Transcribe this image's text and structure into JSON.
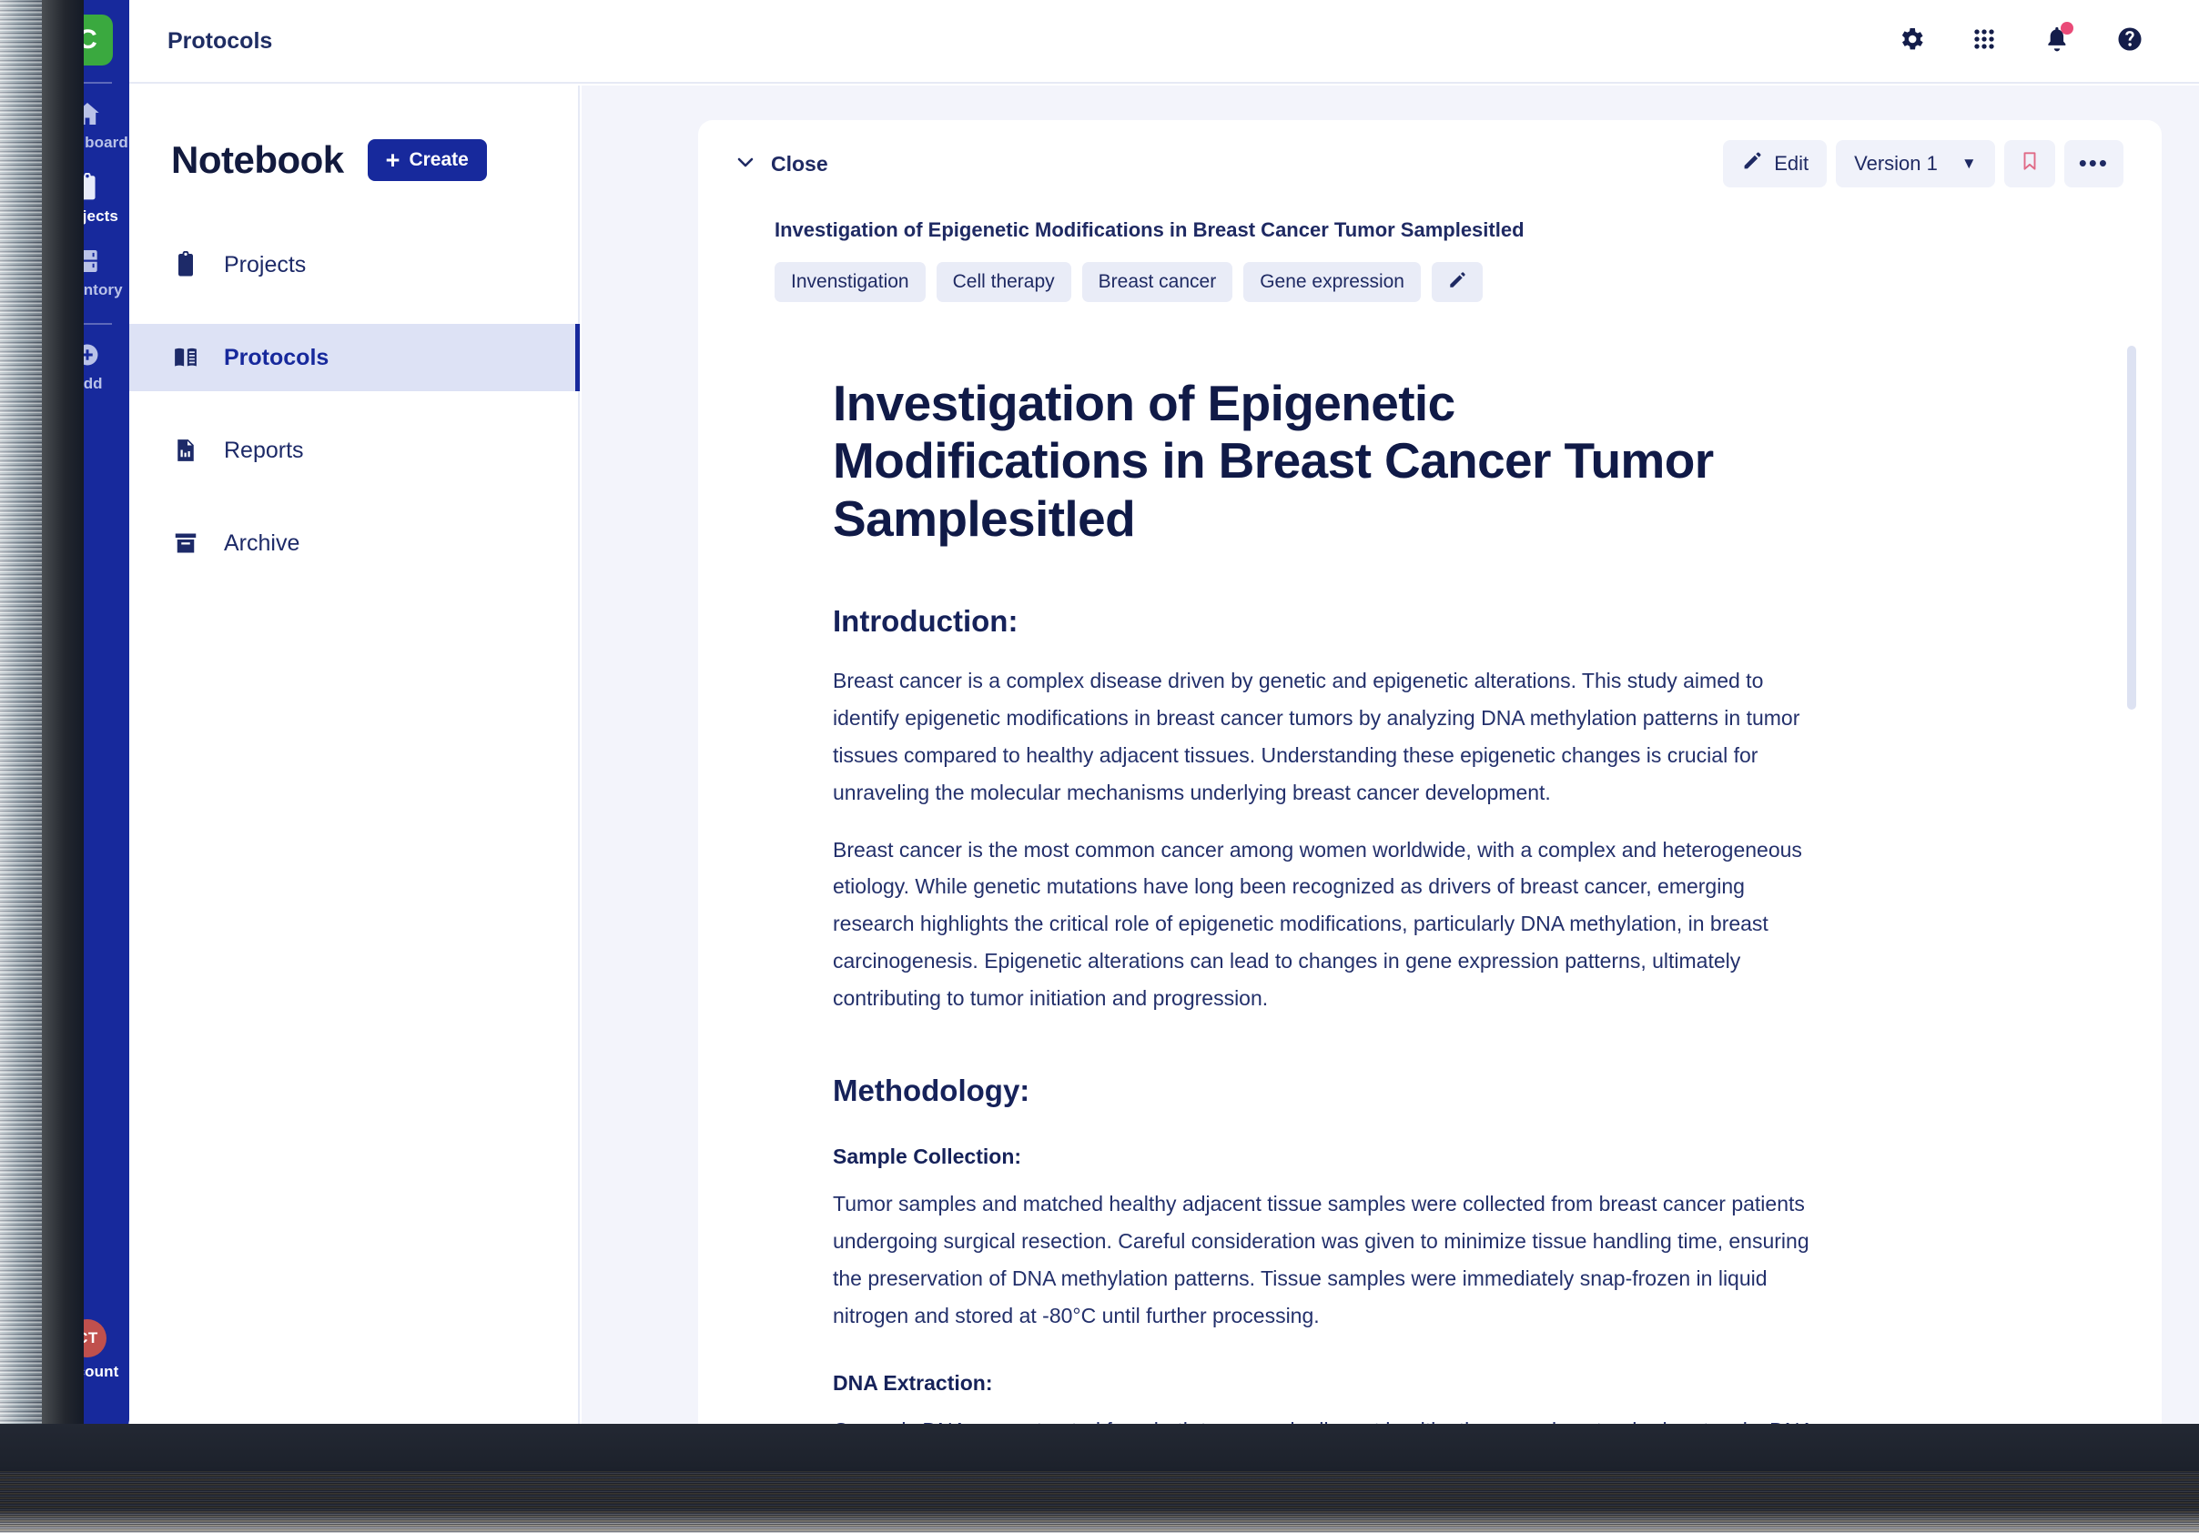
{
  "app": {
    "logo_letter": "C",
    "brand_color": "#3aa93f",
    "rail_color": "#17299c",
    "accent_color": "#17299c",
    "notification_dot_color": "#ea4a78",
    "avatar_color": "#c0504d"
  },
  "rail": {
    "items": [
      {
        "label": "Dashboard",
        "icon": "home-icon",
        "active": false
      },
      {
        "label": "Projects",
        "icon": "clipboard-icon",
        "active": true
      },
      {
        "label": "Inventory",
        "icon": "fridge-icon",
        "active": false
      },
      {
        "label": "Add",
        "icon": "plus-circle-icon",
        "active": false
      }
    ],
    "account": {
      "label": "Account",
      "initials": "CT"
    }
  },
  "topbar": {
    "title": "Protocols",
    "actions": [
      {
        "name": "settings-icon",
        "label": "Settings"
      },
      {
        "name": "apps-grid-icon",
        "label": "Apps"
      },
      {
        "name": "bell-icon",
        "label": "Notifications",
        "has_badge": true
      },
      {
        "name": "help-icon",
        "label": "Help"
      }
    ]
  },
  "notebook": {
    "title": "Notebook",
    "create_label": "Create",
    "create_plus": "+",
    "items": [
      {
        "label": "Projects",
        "icon": "clipboard-icon",
        "active": false
      },
      {
        "label": "Protocols",
        "icon": "book-icon",
        "active": true
      },
      {
        "label": "Reports",
        "icon": "report-chart-icon",
        "active": false
      },
      {
        "label": "Archive",
        "icon": "archive-box-icon",
        "active": false
      }
    ]
  },
  "document": {
    "close_label": "Close",
    "edit_label": "Edit",
    "version_label": "Version 1",
    "version_caret": "▼",
    "more_label": "•••",
    "subtitle": "Investigation of Epigenetic Modifications in Breast Cancer Tumor Samplesitled",
    "tags": [
      "Invenstigation",
      "Cell therapy",
      "Breast cancer",
      "Gene expression"
    ],
    "title": "Investigation of Epigenetic Modifications in Breast Cancer Tumor Samplesitled",
    "sections": {
      "introduction_heading": "Introduction:",
      "introduction_p1": "Breast cancer is a complex disease driven by genetic and epigenetic alterations. This study aimed to identify epigenetic modifications in breast cancer tumors by analyzing DNA methylation patterns in tumor tissues compared to healthy adjacent tissues. Understanding these epigenetic changes is crucial for unraveling the molecular mechanisms underlying breast cancer development.",
      "introduction_p2": "Breast cancer is the most common cancer among women worldwide, with a complex and heterogeneous etiology. While genetic mutations have long been recognized as drivers of breast cancer, emerging research highlights the critical role of epigenetic modifications, particularly DNA methylation, in breast carcinogenesis. Epigenetic alterations can lead to changes in gene expression patterns, ultimately contributing to tumor initiation and progression.",
      "methodology_heading": "Methodology:",
      "sample_collection_heading": "Sample Collection:",
      "sample_collection_p": "Tumor samples and matched healthy adjacent tissue samples were collected from breast cancer patients undergoing surgical resection. Careful consideration was given to minimize tissue handling time, ensuring the preservation of DNA methylation patterns. Tissue samples were immediately snap-frozen in liquid nitrogen and stored at -80°C until further processing.",
      "dna_extraction_heading": "DNA Extraction:",
      "dna_extraction_p": "Genomic DNA was extracted from both tumor and adjacent healthy tissues using standard protocols. DNA quality and quantity were assessed using UV spectrophotometry and gel electrophoresis."
    }
  }
}
